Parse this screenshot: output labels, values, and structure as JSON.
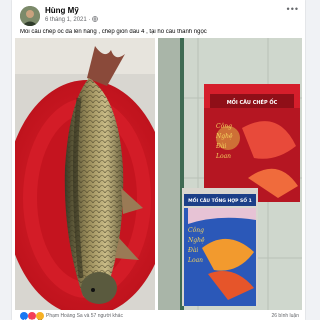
{
  "post": {
    "author": "Hùng Mỹ",
    "date": "6 tháng 1, 2021",
    "visibility_icon": "globe-icon",
    "more_icon": "more-options-icon",
    "more_symbol": "•••",
    "caption": "Mồi câu chép ốc đã lên hàng , chép giòn đầu 4 , tại hồ câu thanh ngọc"
  },
  "product_top": {
    "title": "MỒI CÂU CHÉP ỐC",
    "slogan_lines": [
      "Công",
      "Nghệ",
      "Đài",
      "Loan"
    ]
  },
  "product_bottom": {
    "title": "MỒI CÂU TỔNG HỢP SỐ 1",
    "slogan_lines": [
      "Công",
      "Nghệ",
      "Đài",
      "Loan"
    ]
  },
  "footer": {
    "reactions_text": "Phạm Hoàng Sa và 57 người khác",
    "comments_text": "26 bình luận",
    "reaction_icons": [
      "like-icon",
      "love-icon",
      "haha-icon"
    ],
    "colors": {
      "like": "#1877f2",
      "love": "#f33e58",
      "haha": "#f7b125"
    }
  }
}
